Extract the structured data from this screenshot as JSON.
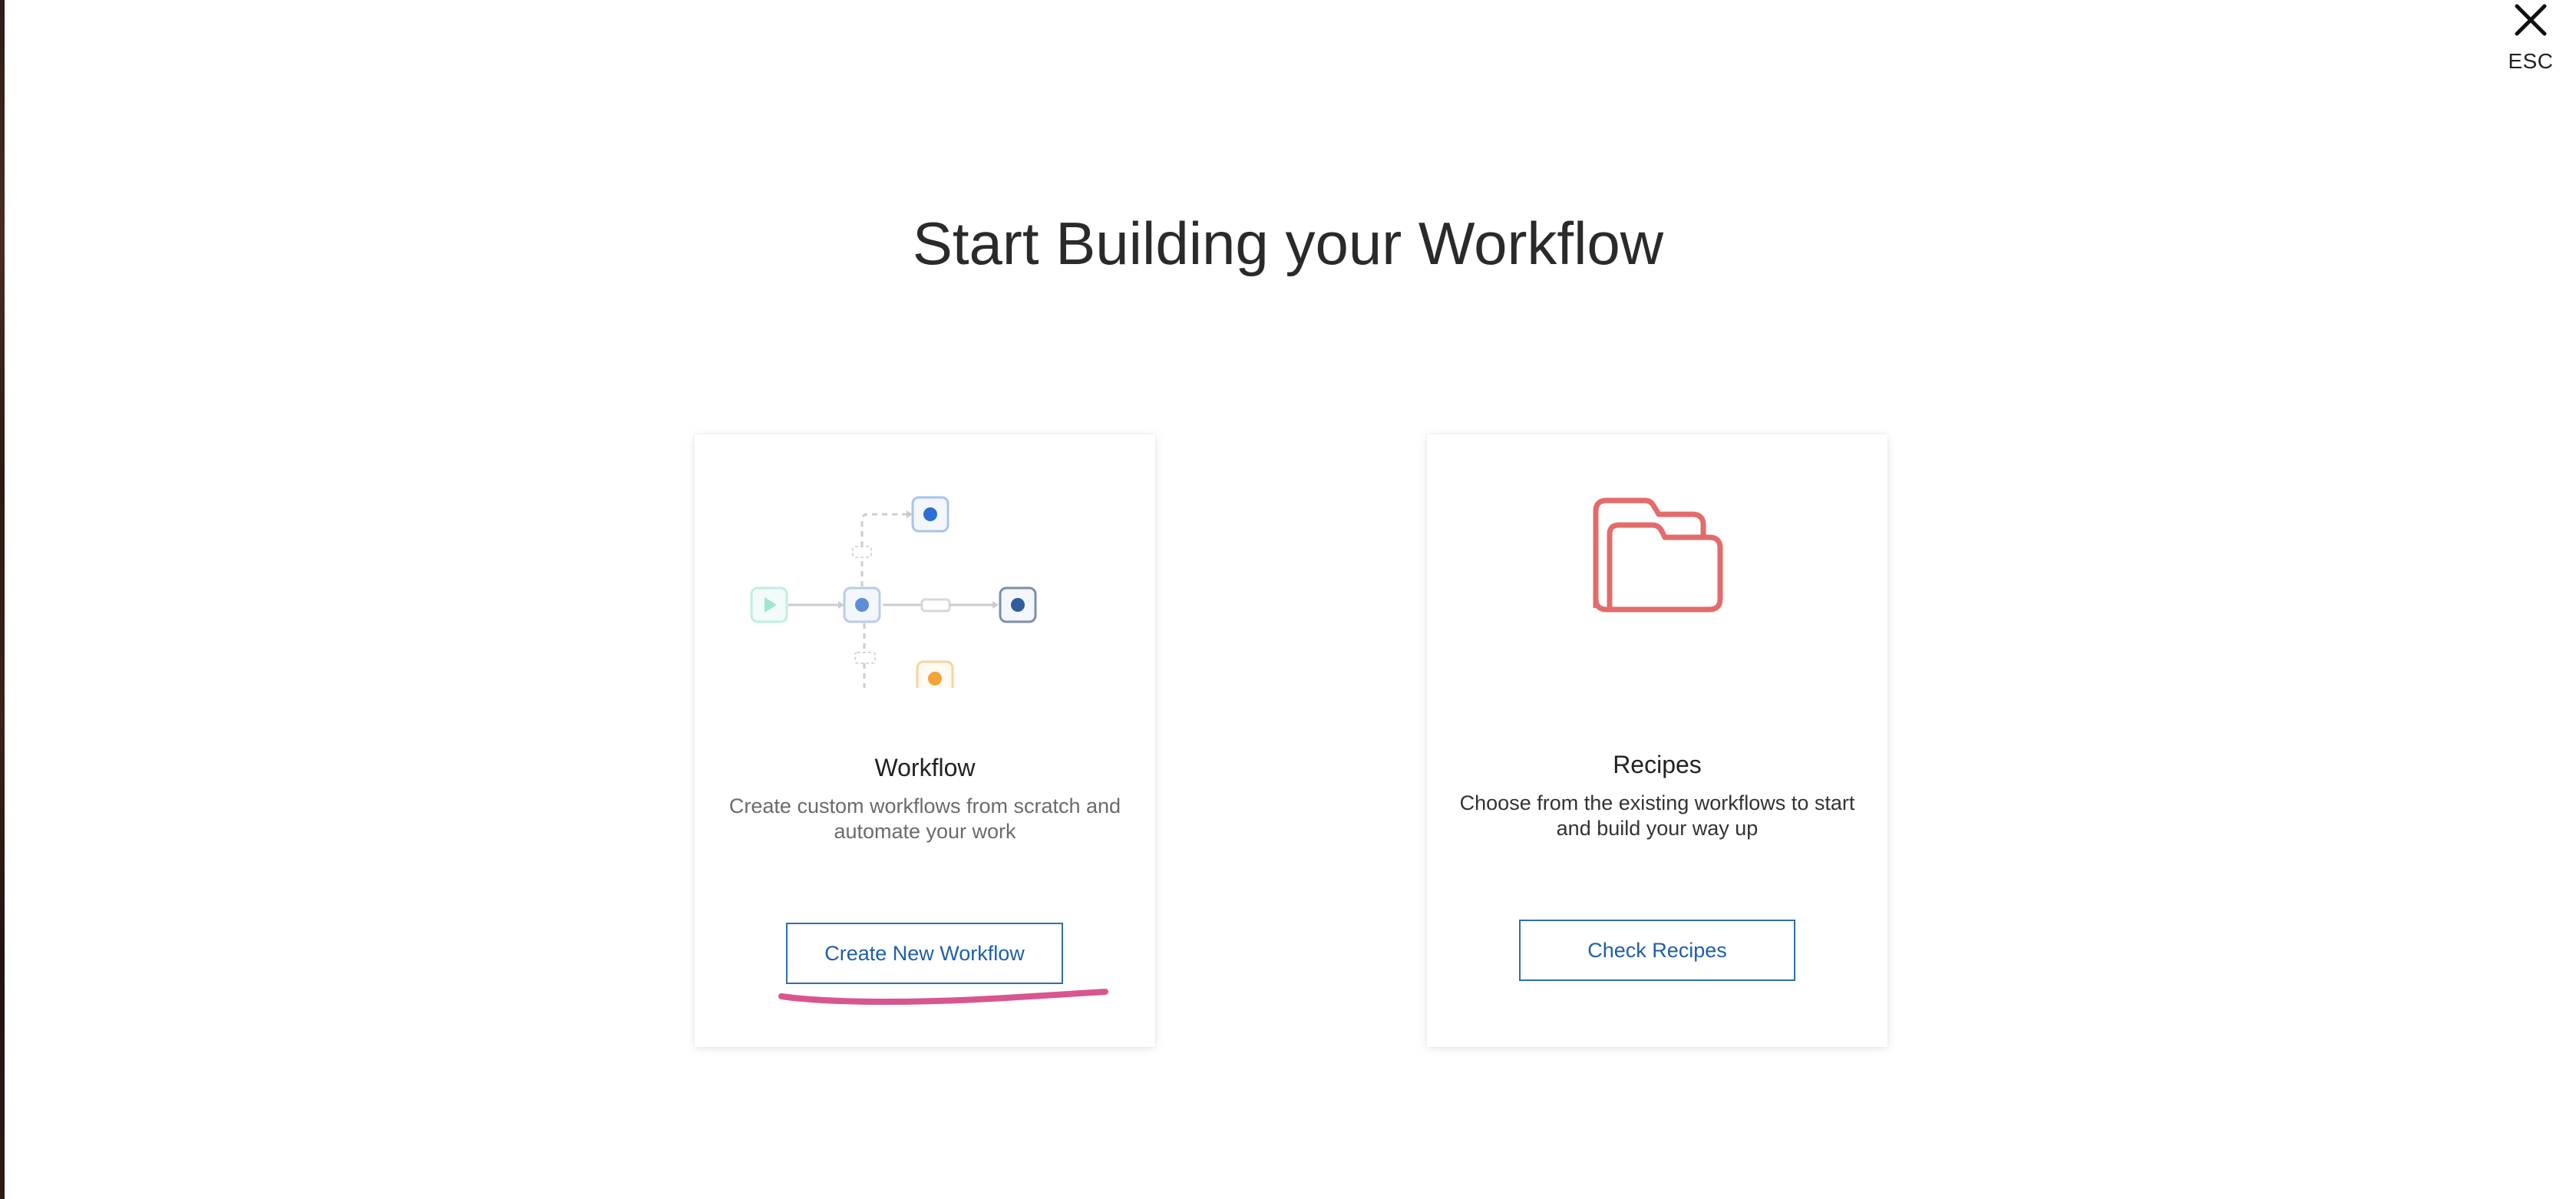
{
  "close": {
    "label": "ESC",
    "icon": "close-icon"
  },
  "page": {
    "title": "Start Building your Workflow"
  },
  "cards": [
    {
      "title": "Workflow",
      "description": "Create custom workflows from scratch and automate your work",
      "button_label": "Create New Workflow",
      "illustration": "workflow-diagram-icon"
    },
    {
      "title": "Recipes",
      "description": "Choose from the existing workflows to start and build your way up",
      "button_label": "Check Recipes",
      "illustration": "folder-icon"
    }
  ],
  "colors": {
    "accent": "#2f6db3",
    "folder": "#e46b6b",
    "annotation": "#d9558f",
    "node_blue": "#3a73d0",
    "node_orange": "#f3a33b",
    "node_green": "#8ed9c8"
  }
}
